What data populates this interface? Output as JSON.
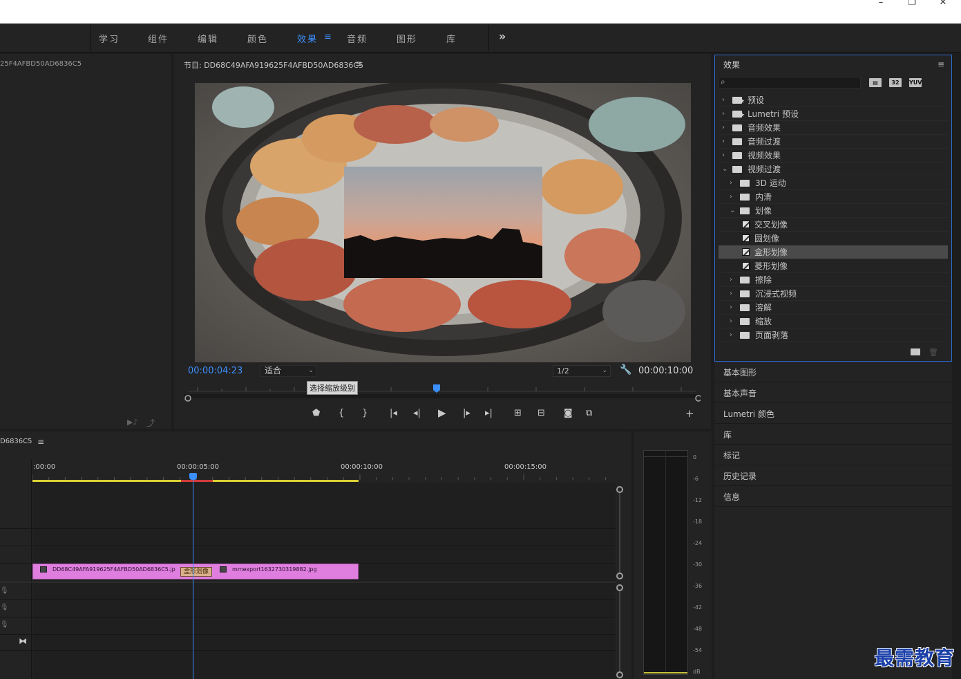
{
  "window": {
    "minimize": "–",
    "maximize": "❐",
    "close": "✕"
  },
  "workspaces": [
    "学习",
    "组件",
    "编辑",
    "颜色",
    "效果",
    "音频",
    "图形",
    "库"
  ],
  "workspace_active": "效果",
  "workspace_menu_icon": "≡",
  "workspace_more": "»",
  "left_panel": {
    "title": "25F4AFBD50AD6836C5"
  },
  "program": {
    "title": "节目: DD68C49AFA919625F4AFBD50AD6836C5",
    "menu_icon": "≡",
    "timecode_current": "00:00:04:23",
    "fit_label": "适合",
    "resolution": "1/2",
    "timecode_duration": "00:00:10:00",
    "tooltip": "选择缩放级别"
  },
  "effects": {
    "title": "效果",
    "menu_icon": "≡",
    "badges": [
      "32",
      "YUV"
    ],
    "tree": [
      {
        "label": "预设",
        "level": 0,
        "expanded": false,
        "type": "preset"
      },
      {
        "label": "Lumetri 预设",
        "level": 0,
        "expanded": false,
        "type": "preset"
      },
      {
        "label": "音频效果",
        "level": 0,
        "expanded": false,
        "type": "folder"
      },
      {
        "label": "音频过渡",
        "level": 0,
        "expanded": false,
        "type": "folder"
      },
      {
        "label": "视频效果",
        "level": 0,
        "expanded": false,
        "type": "folder"
      },
      {
        "label": "视频过渡",
        "level": 0,
        "expanded": true,
        "type": "folder"
      },
      {
        "label": "3D 运动",
        "level": 1,
        "expanded": false,
        "type": "folder"
      },
      {
        "label": "内滑",
        "level": 1,
        "expanded": false,
        "type": "folder"
      },
      {
        "label": "划像",
        "level": 1,
        "expanded": true,
        "type": "folder"
      },
      {
        "label": "交叉划像",
        "level": 2,
        "type": "effect"
      },
      {
        "label": "圆划像",
        "level": 2,
        "type": "effect"
      },
      {
        "label": "盒形划像",
        "level": 2,
        "type": "effect",
        "selected": true
      },
      {
        "label": "菱形划像",
        "level": 2,
        "type": "effect"
      },
      {
        "label": "擦除",
        "level": 1,
        "expanded": false,
        "type": "folder"
      },
      {
        "label": "沉浸式视频",
        "level": 1,
        "expanded": false,
        "type": "folder"
      },
      {
        "label": "溶解",
        "level": 1,
        "expanded": false,
        "type": "folder"
      },
      {
        "label": "缩放",
        "level": 1,
        "expanded": false,
        "type": "folder"
      },
      {
        "label": "页面剥落",
        "level": 1,
        "expanded": false,
        "type": "folder"
      }
    ]
  },
  "side_tabs": [
    "基本图形",
    "基本声音",
    "Lumetri 颜色",
    "库",
    "标记",
    "历史记录",
    "信息"
  ],
  "timeline": {
    "title": "D6836C5",
    "menu_icon": "≡",
    "ruler": [
      ":00:00",
      "00:00:05:00",
      "00:00:10:00",
      "00:00:15:00"
    ],
    "clip_a": "DD68C49AFA919625F4AFBD50AD6836C5.jp",
    "transition": "盒形划像",
    "clip_b": "mmexport1632730319882.jpg"
  },
  "meter": {
    "scale": [
      "0",
      "-6",
      "-12",
      "-18",
      "-24",
      "-30",
      "-36",
      "-42",
      "-48",
      "-54",
      "dB"
    ]
  },
  "watermark": "最需教育"
}
